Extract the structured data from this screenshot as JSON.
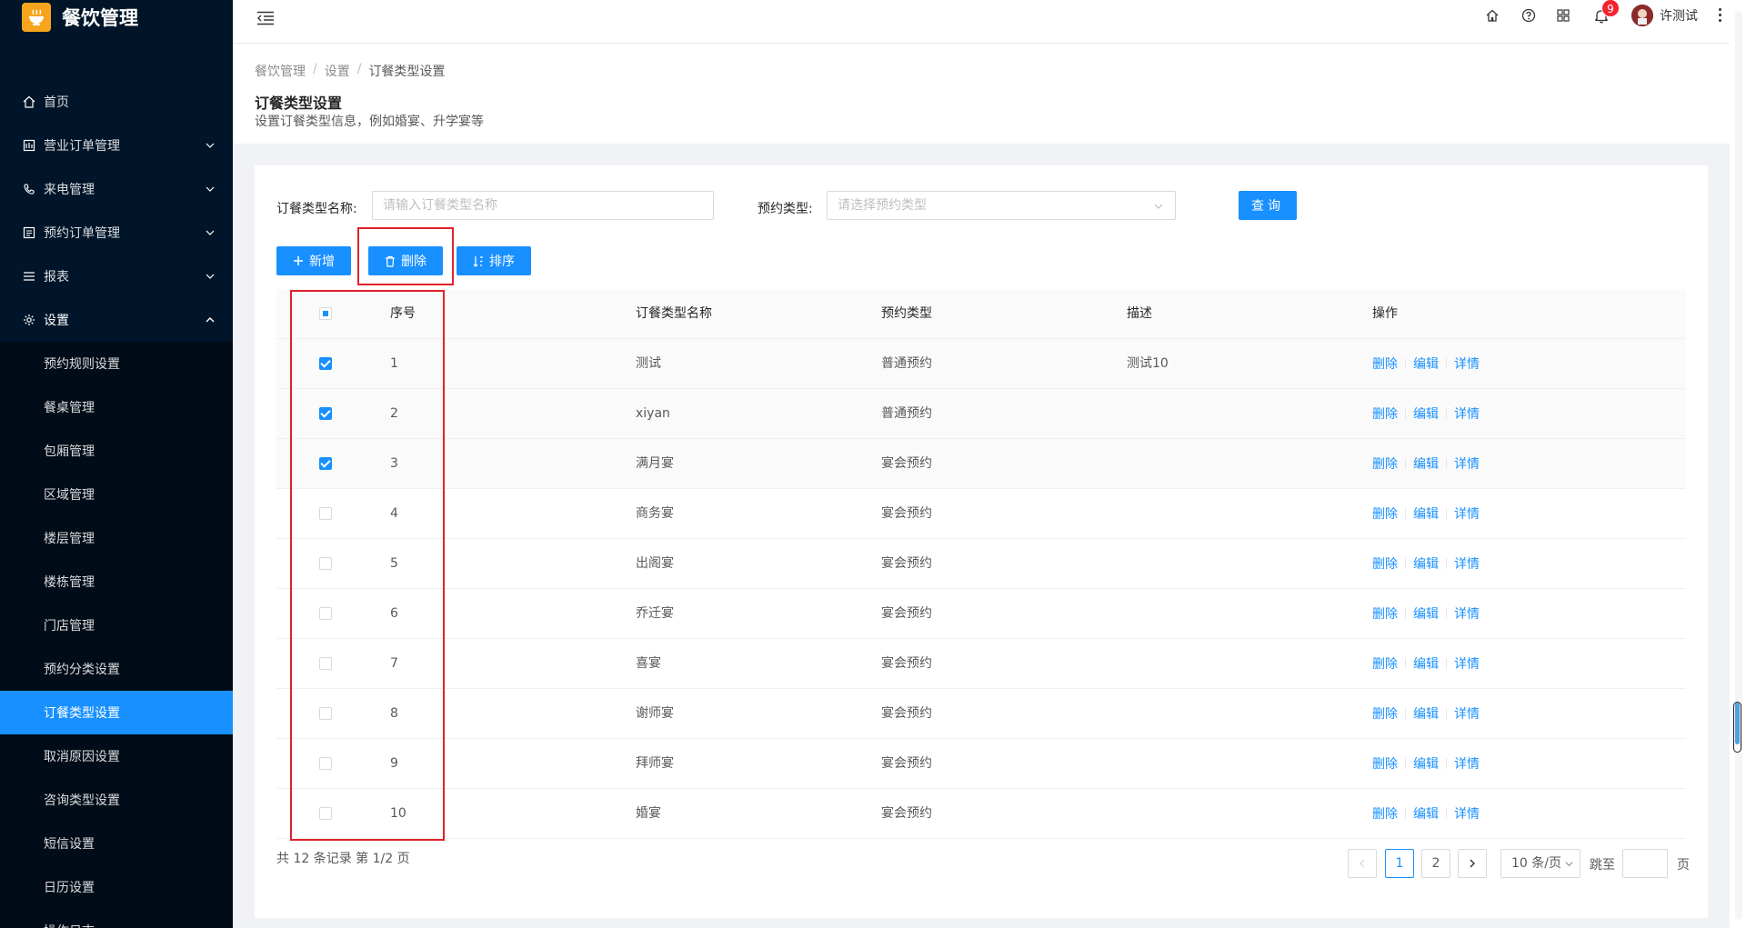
{
  "app": {
    "title": "餐饮管理"
  },
  "sidebar": {
    "items": [
      {
        "label": "首页",
        "icon": "home-icon"
      },
      {
        "label": "营业订单管理",
        "icon": "calendar-icon",
        "has_children": true
      },
      {
        "label": "来电管理",
        "icon": "phone-icon",
        "has_children": true
      },
      {
        "label": "预约订单管理",
        "icon": "list-icon",
        "has_children": true
      },
      {
        "label": "报表",
        "icon": "menu-icon",
        "has_children": true
      },
      {
        "label": "设置",
        "icon": "gear-icon",
        "has_children": true,
        "open": true
      }
    ],
    "settings_children": [
      {
        "label": "预约规则设置"
      },
      {
        "label": "餐桌管理"
      },
      {
        "label": "包厢管理"
      },
      {
        "label": "区域管理"
      },
      {
        "label": "楼层管理"
      },
      {
        "label": "楼栋管理"
      },
      {
        "label": "门店管理"
      },
      {
        "label": "预约分类设置"
      },
      {
        "label": "订餐类型设置",
        "active": true
      },
      {
        "label": "取消原因设置"
      },
      {
        "label": "咨询类型设置"
      },
      {
        "label": "短信设置"
      },
      {
        "label": "日历设置"
      },
      {
        "label": "操作日志"
      }
    ]
  },
  "header": {
    "notification_count": "9",
    "user_name": "许测试"
  },
  "breadcrumb": [
    "餐饮管理",
    "设置",
    "订餐类型设置"
  ],
  "page": {
    "title": "订餐类型设置",
    "description": "设置订餐类型信息，例如婚宴、升学宴等"
  },
  "filters": {
    "name_label": "订餐类型名称:",
    "name_placeholder": "请输入订餐类型名称",
    "type_label": "预约类型:",
    "type_placeholder": "请选择预约类型",
    "query_label": "查询"
  },
  "toolbar": {
    "add_label": "新增",
    "delete_label": "删除",
    "sort_label": "排序"
  },
  "table": {
    "columns": [
      "序号",
      "订餐类型名称",
      "预约类型",
      "描述",
      "操作"
    ],
    "rows": [
      {
        "index": "1",
        "name": "测试",
        "type": "普通预约",
        "desc": "测试10",
        "checked": true
      },
      {
        "index": "2",
        "name": "xiyan",
        "type": "普通预约",
        "desc": "",
        "checked": true
      },
      {
        "index": "3",
        "name": "满月宴",
        "type": "宴会预约",
        "desc": "",
        "checked": true
      },
      {
        "index": "4",
        "name": "商务宴",
        "type": "宴会预约",
        "desc": "",
        "checked": false
      },
      {
        "index": "5",
        "name": "出阁宴",
        "type": "宴会预约",
        "desc": "",
        "checked": false
      },
      {
        "index": "6",
        "name": "乔迁宴",
        "type": "宴会预约",
        "desc": "",
        "checked": false
      },
      {
        "index": "7",
        "name": "喜宴",
        "type": "宴会预约",
        "desc": "",
        "checked": false
      },
      {
        "index": "8",
        "name": "谢师宴",
        "type": "宴会预约",
        "desc": "",
        "checked": false
      },
      {
        "index": "9",
        "name": "拜师宴",
        "type": "宴会预约",
        "desc": "",
        "checked": false
      },
      {
        "index": "10",
        "name": "婚宴",
        "type": "宴会预约",
        "desc": "",
        "checked": false
      }
    ],
    "actions": [
      "删除",
      "编辑",
      "详情"
    ]
  },
  "pagination": {
    "total_text": "共 12 条记录 第 1/2 页",
    "pages": [
      "1",
      "2"
    ],
    "current_page": "1",
    "page_size": "10 条/页",
    "jump_label": "跳至",
    "page_suffix": "页"
  },
  "colors": {
    "sidebar_bg": "#001529",
    "primary": "#1890ff",
    "highlight_red": "#e0222a",
    "badge_red": "#f5222d",
    "logo_orange": "#f7a51c"
  }
}
